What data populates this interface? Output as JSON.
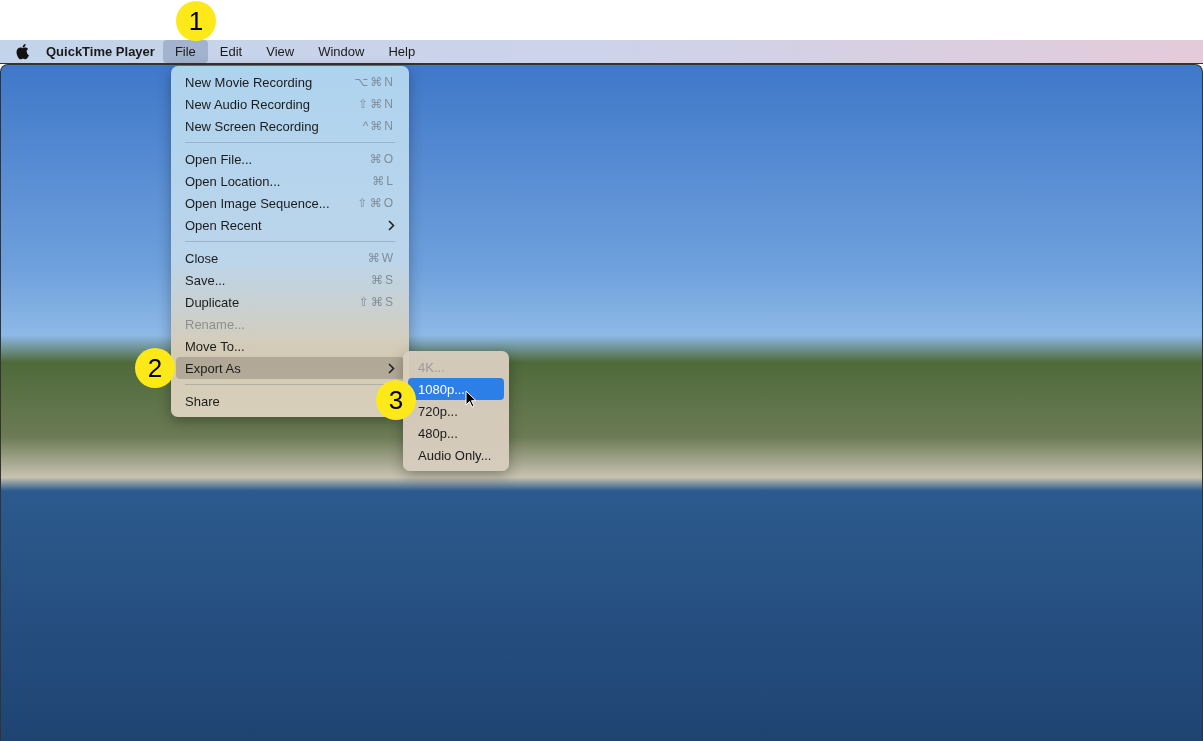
{
  "menu_bar": {
    "app_name": "QuickTime Player",
    "menus": [
      {
        "label": "File",
        "selected": true
      },
      {
        "label": "Edit",
        "selected": false
      },
      {
        "label": "View",
        "selected": false
      },
      {
        "label": "Window",
        "selected": false
      },
      {
        "label": "Help",
        "selected": false
      }
    ]
  },
  "file_menu": {
    "items": [
      {
        "kind": "item",
        "label": "New Movie Recording",
        "shortcut": "⌥⌘N",
        "disabled": false,
        "selected": false
      },
      {
        "kind": "item",
        "label": "New Audio Recording",
        "shortcut": "⇧⌘N",
        "disabled": false,
        "selected": false
      },
      {
        "kind": "item",
        "label": "New Screen Recording",
        "shortcut": "^⌘N",
        "disabled": false,
        "selected": false
      },
      {
        "kind": "separator"
      },
      {
        "kind": "item",
        "label": "Open File...",
        "shortcut": "⌘O",
        "disabled": false,
        "selected": false
      },
      {
        "kind": "item",
        "label": "Open Location...",
        "shortcut": "⌘L",
        "disabled": false,
        "selected": false
      },
      {
        "kind": "item",
        "label": "Open Image Sequence...",
        "shortcut": "⇧⌘O",
        "disabled": false,
        "selected": false
      },
      {
        "kind": "submenu",
        "label": "Open Recent",
        "disabled": false,
        "selected": false
      },
      {
        "kind": "separator"
      },
      {
        "kind": "item",
        "label": "Close",
        "shortcut": "⌘W",
        "disabled": false,
        "selected": false
      },
      {
        "kind": "item",
        "label": "Save...",
        "shortcut": "⌘S",
        "disabled": false,
        "selected": false
      },
      {
        "kind": "item",
        "label": "Duplicate",
        "shortcut": "⇧⌘S",
        "disabled": false,
        "selected": false
      },
      {
        "kind": "item",
        "label": "Rename...",
        "disabled": true,
        "selected": false
      },
      {
        "kind": "item",
        "label": "Move To...",
        "disabled": false,
        "selected": false
      },
      {
        "kind": "submenu",
        "label": "Export As",
        "disabled": false,
        "selected": true
      },
      {
        "kind": "separator"
      },
      {
        "kind": "item",
        "label": "Share",
        "disabled": false,
        "selected": false
      }
    ]
  },
  "export_submenu": {
    "items": [
      {
        "label": "4K...",
        "disabled": true,
        "selected": false
      },
      {
        "label": "1080p...",
        "disabled": false,
        "selected": true
      },
      {
        "label": "720p...",
        "disabled": false,
        "selected": false
      },
      {
        "label": "480p...",
        "disabled": false,
        "selected": false
      },
      {
        "label": "Audio Only...",
        "disabled": false,
        "selected": false
      }
    ]
  },
  "callouts": [
    "1",
    "2",
    "3"
  ]
}
